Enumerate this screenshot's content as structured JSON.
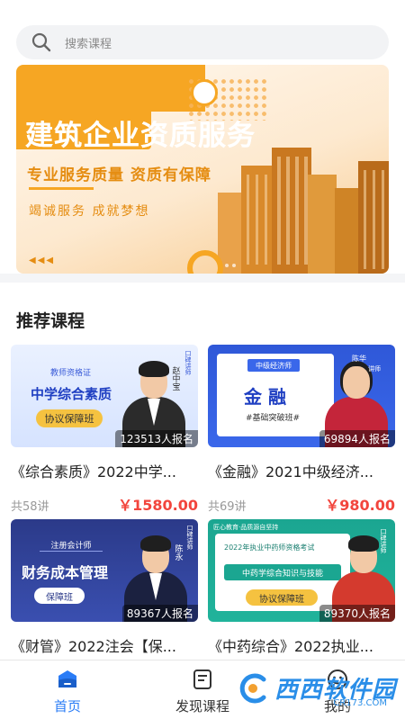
{
  "search": {
    "placeholder": "搜索课程"
  },
  "banner": {
    "title": "建筑企业资质服务",
    "subtitle": "专业服务质量 资质有保障",
    "slogan": "竭诚服务  成就梦想",
    "arrows": "◀◀◀"
  },
  "section": {
    "title": "推荐课程"
  },
  "courses": [
    {
      "title": "《综合素质》2022中学...",
      "enrolled": "123513人报名",
      "lessons": "共58讲",
      "price": "￥1580.00",
      "thumb": {
        "tag": "教师资格证",
        "headline": "中学综合素质",
        "badge": "协议保障班",
        "teacher": "赵中宝",
        "side": "口碑讲师"
      }
    },
    {
      "title": "《金融》2021中级经济...",
      "enrolled": "69894人报名",
      "lessons": "共69讲",
      "price": "￥980.00",
      "thumb": {
        "tag": "中级经济师",
        "headline": "金 融",
        "badge": "#基础突破班#",
        "teacher": "陈华",
        "side": "讲师"
      }
    },
    {
      "title": "《财管》2022注会【保...",
      "enrolled": "89367人报名",
      "lessons": "",
      "price": "",
      "thumb": {
        "tag": "注册会计师",
        "headline": "财务成本管理",
        "badge": "保障班",
        "teacher": "陈永",
        "side": "口碑讲师"
      }
    },
    {
      "title": "《中药综合》2022执业...",
      "enrolled": "89370人报名",
      "lessons": "",
      "price": "",
      "thumb": {
        "tag": "匠心教育·品质源自坚持",
        "headline": "中药学综合知识与技能",
        "top": "2022年执业中药师资格考试",
        "badge": "协议保障班",
        "teacher": "",
        "side": "口碑讲师"
      }
    }
  ],
  "nav": [
    {
      "label": "首页",
      "icon": "home-icon",
      "active": true
    },
    {
      "label": "发现课程",
      "icon": "discover-icon",
      "active": false
    },
    {
      "label": "我的",
      "icon": "profile-icon",
      "active": false
    }
  ],
  "watermark": {
    "text": "西西软件园",
    "sub": "CR173.COM"
  },
  "colors": {
    "accent": "#2a7cf6",
    "price": "#f2453d",
    "banner_orange": "#f6a623"
  }
}
